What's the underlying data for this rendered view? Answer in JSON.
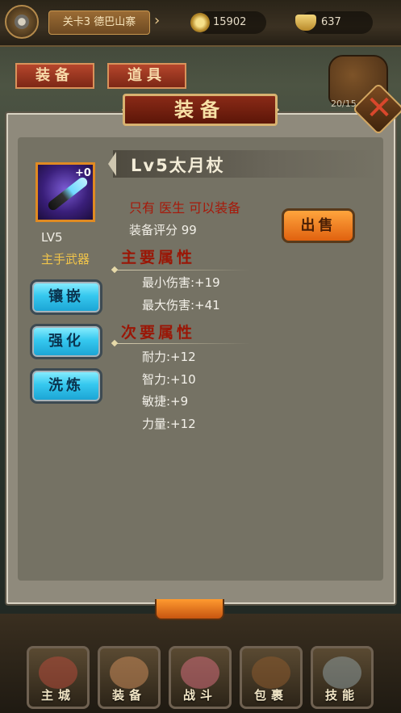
{
  "header": {
    "stage_label": "关卡3 德巴山寨",
    "coins": "15902",
    "gems": "637"
  },
  "tabs": [
    {
      "label": "装备"
    },
    {
      "label": "道具"
    }
  ],
  "bag_capacity": "20/15",
  "panel": {
    "title": "装备"
  },
  "item": {
    "plus": "+0",
    "level": "LV5",
    "kind": "主手武器",
    "name": "Lv5太月杖",
    "restriction": "只有 医生 可以装备",
    "score": "装备评分 99"
  },
  "actions": {
    "inlay": "镶嵌",
    "strengthen": "强化",
    "refine": "洗炼",
    "sell": "出售"
  },
  "primary": {
    "heading": "主要属性",
    "stats": [
      "最小伤害:+19",
      "最大伤害:+41"
    ]
  },
  "secondary": {
    "heading": "次要属性",
    "stats": [
      "耐力:+12",
      "智力:+10",
      "敏捷:+9",
      "力量:+12"
    ]
  },
  "dock": [
    {
      "label": "主城",
      "icon": "castle-icon"
    },
    {
      "label": "装备",
      "icon": "hero-icon"
    },
    {
      "label": "战斗",
      "icon": "sword-icon"
    },
    {
      "label": "包裹",
      "icon": "bag-icon"
    },
    {
      "label": "技能",
      "icon": "crossed-swords-icon"
    }
  ]
}
